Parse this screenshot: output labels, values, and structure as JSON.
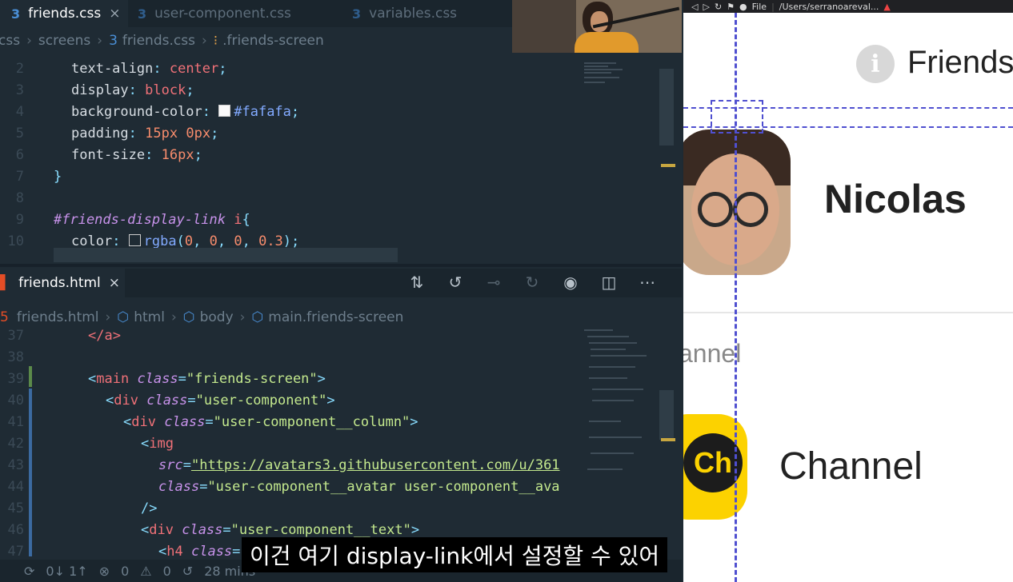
{
  "editor": {
    "tabs_top": [
      {
        "label": "friends.css",
        "active": true,
        "close": "×"
      },
      {
        "label": "user-component.css",
        "active": false
      },
      {
        "label": "variables.css",
        "active": false
      }
    ],
    "css_breadcrumb": [
      "css",
      "screens",
      "friends.css",
      ".friends-screen"
    ],
    "css_lines": [
      {
        "n": "2"
      },
      {
        "n": "3"
      },
      {
        "n": "4"
      },
      {
        "n": "5"
      },
      {
        "n": "6"
      },
      {
        "n": "7"
      },
      {
        "n": "8"
      },
      {
        "n": "9"
      },
      {
        "n": "10"
      }
    ],
    "css_code": {
      "l2_prop": "text-align",
      "l2_val": "center",
      "l3_prop": "display",
      "l3_val": "block",
      "l4_prop": "background-color",
      "l4_val": "#fafafa",
      "l5_prop": "padding",
      "l5_val1": "15px",
      "l5_val2": "0px",
      "l6_prop": "font-size",
      "l6_val": "16px",
      "l7": "}",
      "l9_sel": "#friends-display-link",
      "l9_el": "i",
      "l9_brace": "{",
      "l10_prop": "color",
      "l10_fn": "rgba",
      "l10_a": "0",
      "l10_b": "0",
      "l10_c": "0",
      "l10_d": "0.3"
    },
    "html_tab": {
      "label": "friends.html",
      "close": "×"
    },
    "html_breadcrumb": [
      "friends.html",
      "html",
      "body",
      "main.friends-screen"
    ],
    "html_lines": [
      "37",
      "38",
      "39",
      "40",
      "41",
      "42",
      "43",
      "44",
      "45",
      "46",
      "47"
    ],
    "html_code": {
      "l37": "</a>",
      "l39_tag": "main",
      "l39_attr": "class",
      "l39_val": "\"friends-screen\"",
      "l40_tag": "div",
      "l40_attr": "class",
      "l40_val": "\"user-component\"",
      "l41_tag": "div",
      "l41_attr": "class",
      "l41_val": "\"user-component__column\"",
      "l42_tag": "img",
      "l43_attr": "src",
      "l43_val": "\"https://avatars3.githubusercontent.com/u/361",
      "l44_attr": "class",
      "l44_val": "\"user-component__avatar user-component__ava",
      "l45": "/>",
      "l46_tag": "div",
      "l46_attr": "class",
      "l46_val": "\"user-component__text\"",
      "l47_tag": "h4",
      "l47_attr": "class"
    },
    "status": {
      "sync": "0↓ 1↑",
      "problems": "0",
      "warnings": "0",
      "time": "28 mins"
    }
  },
  "browser": {
    "url_label": "File",
    "url": "/Users/serranoareval...",
    "header_title": "Friends",
    "user_name": "Nicolas",
    "section_label": "annel",
    "channel_name": "Channel",
    "channel_badge": "Ch"
  },
  "subtitle": "이건 여기 display-link에서 설정할 수 있어"
}
